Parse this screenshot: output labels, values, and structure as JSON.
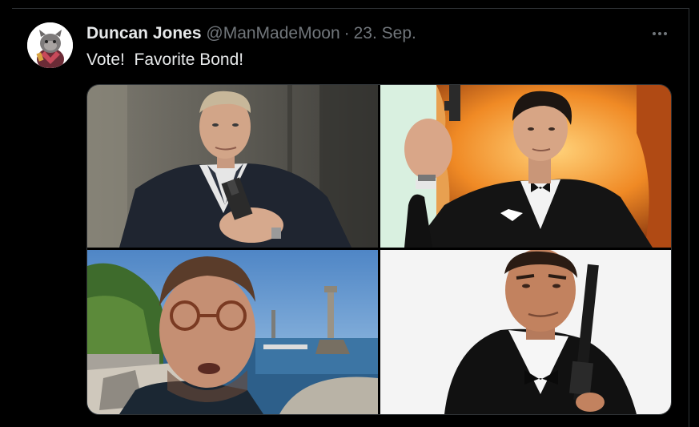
{
  "tweet": {
    "author_name": "Duncan Jones",
    "handle": "@ManMadeMoon",
    "separator": "·",
    "date": "23. Sep.",
    "text": "Vote!  Favorite Bond!",
    "more_icon": "more-horizontal-icon"
  },
  "media": [
    {
      "subject": "man in dark suit aiming pistol in front of stone wall"
    },
    {
      "subject": "man in tuxedo holding pistol before flames"
    },
    {
      "subject": "man with glasses on seaside promenade with monument"
    },
    {
      "subject": "man in tuxedo holding pistol on white background"
    }
  ],
  "colors": {
    "background": "#000000",
    "text": "#e7e9ea",
    "muted": "#71767b",
    "border": "#2f3336"
  }
}
